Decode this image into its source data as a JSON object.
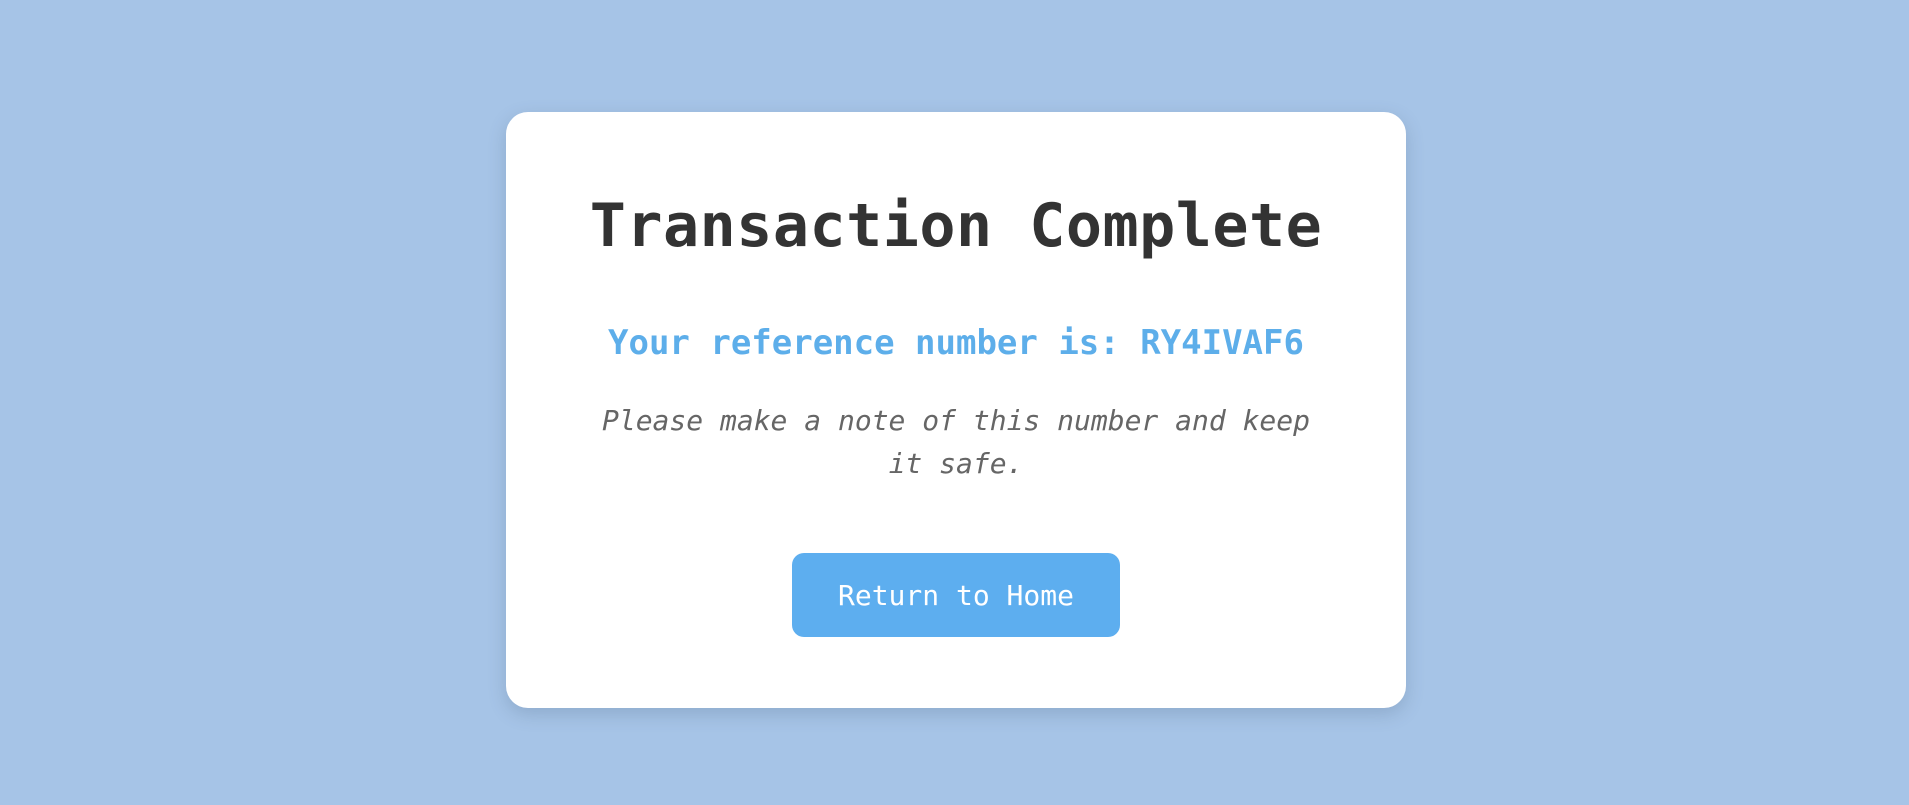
{
  "confirmation": {
    "title": "Transaction Complete",
    "reference_text": "Your reference number is: RY4IVAF6",
    "note": "Please make a note of this number and keep it safe.",
    "button_label": "Return to Home"
  },
  "colors": {
    "background": "#a6c4e7",
    "card": "#ffffff",
    "title_text": "#333333",
    "accent": "#5daeea",
    "note_text": "#666666",
    "button_text": "#ffffff"
  }
}
